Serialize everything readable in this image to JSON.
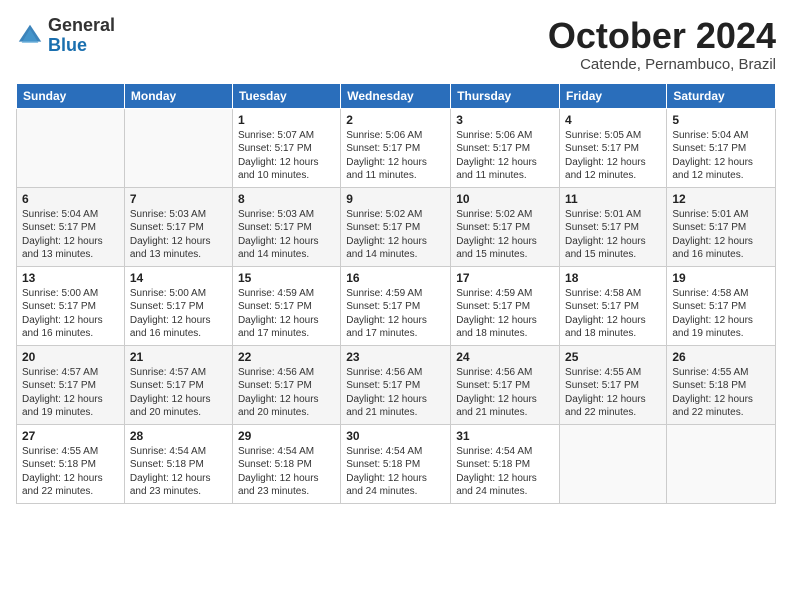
{
  "logo": {
    "general": "General",
    "blue": "Blue"
  },
  "header": {
    "month": "October 2024",
    "location": "Catende, Pernambuco, Brazil"
  },
  "days_of_week": [
    "Sunday",
    "Monday",
    "Tuesday",
    "Wednesday",
    "Thursday",
    "Friday",
    "Saturday"
  ],
  "weeks": [
    [
      {
        "day": "",
        "info": ""
      },
      {
        "day": "",
        "info": ""
      },
      {
        "day": "1",
        "info": "Sunrise: 5:07 AM\nSunset: 5:17 PM\nDaylight: 12 hours\nand 10 minutes."
      },
      {
        "day": "2",
        "info": "Sunrise: 5:06 AM\nSunset: 5:17 PM\nDaylight: 12 hours\nand 11 minutes."
      },
      {
        "day": "3",
        "info": "Sunrise: 5:06 AM\nSunset: 5:17 PM\nDaylight: 12 hours\nand 11 minutes."
      },
      {
        "day": "4",
        "info": "Sunrise: 5:05 AM\nSunset: 5:17 PM\nDaylight: 12 hours\nand 12 minutes."
      },
      {
        "day": "5",
        "info": "Sunrise: 5:04 AM\nSunset: 5:17 PM\nDaylight: 12 hours\nand 12 minutes."
      }
    ],
    [
      {
        "day": "6",
        "info": "Sunrise: 5:04 AM\nSunset: 5:17 PM\nDaylight: 12 hours\nand 13 minutes."
      },
      {
        "day": "7",
        "info": "Sunrise: 5:03 AM\nSunset: 5:17 PM\nDaylight: 12 hours\nand 13 minutes."
      },
      {
        "day": "8",
        "info": "Sunrise: 5:03 AM\nSunset: 5:17 PM\nDaylight: 12 hours\nand 14 minutes."
      },
      {
        "day": "9",
        "info": "Sunrise: 5:02 AM\nSunset: 5:17 PM\nDaylight: 12 hours\nand 14 minutes."
      },
      {
        "day": "10",
        "info": "Sunrise: 5:02 AM\nSunset: 5:17 PM\nDaylight: 12 hours\nand 15 minutes."
      },
      {
        "day": "11",
        "info": "Sunrise: 5:01 AM\nSunset: 5:17 PM\nDaylight: 12 hours\nand 15 minutes."
      },
      {
        "day": "12",
        "info": "Sunrise: 5:01 AM\nSunset: 5:17 PM\nDaylight: 12 hours\nand 16 minutes."
      }
    ],
    [
      {
        "day": "13",
        "info": "Sunrise: 5:00 AM\nSunset: 5:17 PM\nDaylight: 12 hours\nand 16 minutes."
      },
      {
        "day": "14",
        "info": "Sunrise: 5:00 AM\nSunset: 5:17 PM\nDaylight: 12 hours\nand 16 minutes."
      },
      {
        "day": "15",
        "info": "Sunrise: 4:59 AM\nSunset: 5:17 PM\nDaylight: 12 hours\nand 17 minutes."
      },
      {
        "day": "16",
        "info": "Sunrise: 4:59 AM\nSunset: 5:17 PM\nDaylight: 12 hours\nand 17 minutes."
      },
      {
        "day": "17",
        "info": "Sunrise: 4:59 AM\nSunset: 5:17 PM\nDaylight: 12 hours\nand 18 minutes."
      },
      {
        "day": "18",
        "info": "Sunrise: 4:58 AM\nSunset: 5:17 PM\nDaylight: 12 hours\nand 18 minutes."
      },
      {
        "day": "19",
        "info": "Sunrise: 4:58 AM\nSunset: 5:17 PM\nDaylight: 12 hours\nand 19 minutes."
      }
    ],
    [
      {
        "day": "20",
        "info": "Sunrise: 4:57 AM\nSunset: 5:17 PM\nDaylight: 12 hours\nand 19 minutes."
      },
      {
        "day": "21",
        "info": "Sunrise: 4:57 AM\nSunset: 5:17 PM\nDaylight: 12 hours\nand 20 minutes."
      },
      {
        "day": "22",
        "info": "Sunrise: 4:56 AM\nSunset: 5:17 PM\nDaylight: 12 hours\nand 20 minutes."
      },
      {
        "day": "23",
        "info": "Sunrise: 4:56 AM\nSunset: 5:17 PM\nDaylight: 12 hours\nand 21 minutes."
      },
      {
        "day": "24",
        "info": "Sunrise: 4:56 AM\nSunset: 5:17 PM\nDaylight: 12 hours\nand 21 minutes."
      },
      {
        "day": "25",
        "info": "Sunrise: 4:55 AM\nSunset: 5:17 PM\nDaylight: 12 hours\nand 22 minutes."
      },
      {
        "day": "26",
        "info": "Sunrise: 4:55 AM\nSunset: 5:18 PM\nDaylight: 12 hours\nand 22 minutes."
      }
    ],
    [
      {
        "day": "27",
        "info": "Sunrise: 4:55 AM\nSunset: 5:18 PM\nDaylight: 12 hours\nand 22 minutes."
      },
      {
        "day": "28",
        "info": "Sunrise: 4:54 AM\nSunset: 5:18 PM\nDaylight: 12 hours\nand 23 minutes."
      },
      {
        "day": "29",
        "info": "Sunrise: 4:54 AM\nSunset: 5:18 PM\nDaylight: 12 hours\nand 23 minutes."
      },
      {
        "day": "30",
        "info": "Sunrise: 4:54 AM\nSunset: 5:18 PM\nDaylight: 12 hours\nand 24 minutes."
      },
      {
        "day": "31",
        "info": "Sunrise: 4:54 AM\nSunset: 5:18 PM\nDaylight: 12 hours\nand 24 minutes."
      },
      {
        "day": "",
        "info": ""
      },
      {
        "day": "",
        "info": ""
      }
    ]
  ]
}
